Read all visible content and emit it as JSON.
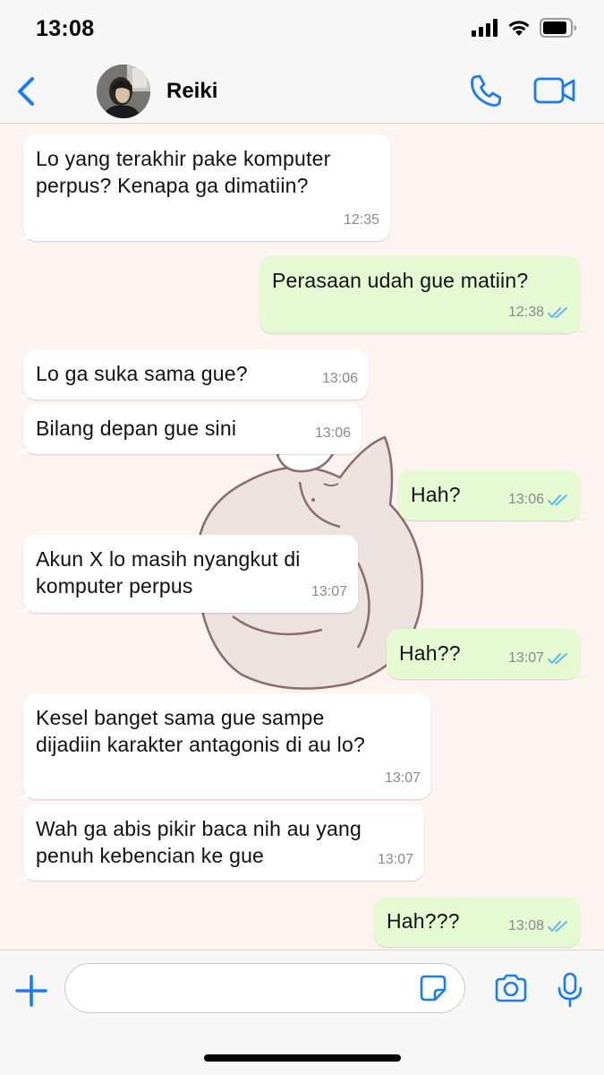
{
  "status_bar": {
    "time": "13:08"
  },
  "header": {
    "contact_name": "Reiki"
  },
  "colors": {
    "accent": "#1a7cf2",
    "outgoing_bubble": "#e5f9d2",
    "incoming_bubble": "#ffffff",
    "chat_background": "#fdf3f1",
    "read_ticks": "#4fb6ec"
  },
  "icons": [
    "back-chevron-icon",
    "phone-icon",
    "video-camera-icon",
    "plus-icon",
    "sticker-icon",
    "camera-icon",
    "microphone-icon",
    "double-check-icon"
  ],
  "messages": [
    {
      "direction": "incoming",
      "text": "Lo yang terakhir pake komputer\nperpus? Kenapa ga dimatiin?",
      "time": "12:35"
    },
    {
      "direction": "outgoing",
      "text": "Perasaan udah gue matiin?",
      "time": "12:38",
      "read": true
    },
    {
      "direction": "incoming",
      "text": "Lo ga suka sama gue?",
      "time": "13:06"
    },
    {
      "direction": "incoming",
      "text": "Bilang depan gue sini",
      "time": "13:06"
    },
    {
      "direction": "outgoing",
      "text": "Hah?",
      "time": "13:06",
      "read": true
    },
    {
      "direction": "incoming",
      "text": "Akun X lo masih nyangkut di\nkomputer perpus",
      "time": "13:07"
    },
    {
      "direction": "outgoing",
      "text": "Hah??",
      "time": "13:07",
      "read": true
    },
    {
      "direction": "incoming",
      "text": "Kesel banget sama gue sampe\ndijadiin karakter antagonis di au lo?",
      "time": "13:07"
    },
    {
      "direction": "incoming",
      "text": "Wah ga abis pikir baca nih au yang\npenuh kebencian ke gue",
      "time": "13:07"
    },
    {
      "direction": "outgoing",
      "text": "Hah???",
      "time": "13:08",
      "read": true
    }
  ],
  "composer": {
    "value": "",
    "placeholder": ""
  }
}
